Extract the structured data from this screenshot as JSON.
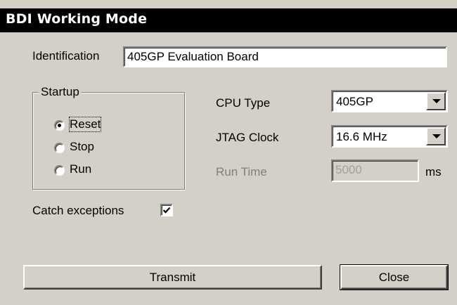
{
  "window": {
    "title": "BDI Working Mode"
  },
  "identification": {
    "label": "Identification",
    "value": "405GP Evaluation Board"
  },
  "startup": {
    "group_label": "Startup",
    "options": [
      {
        "label": "Reset",
        "selected": true
      },
      {
        "label": "Stop",
        "selected": false
      },
      {
        "label": "Run",
        "selected": false
      }
    ]
  },
  "cpu_type": {
    "label": "CPU Type",
    "value": "405GP"
  },
  "jtag_clock": {
    "label": "JTAG Clock",
    "value": "16.6 MHz"
  },
  "run_time": {
    "label": "Run Time",
    "value": "5000",
    "unit": "ms",
    "enabled": false
  },
  "catch_exceptions": {
    "label": "Catch exceptions",
    "checked": true
  },
  "buttons": {
    "transmit": "Transmit",
    "close": "Close"
  }
}
